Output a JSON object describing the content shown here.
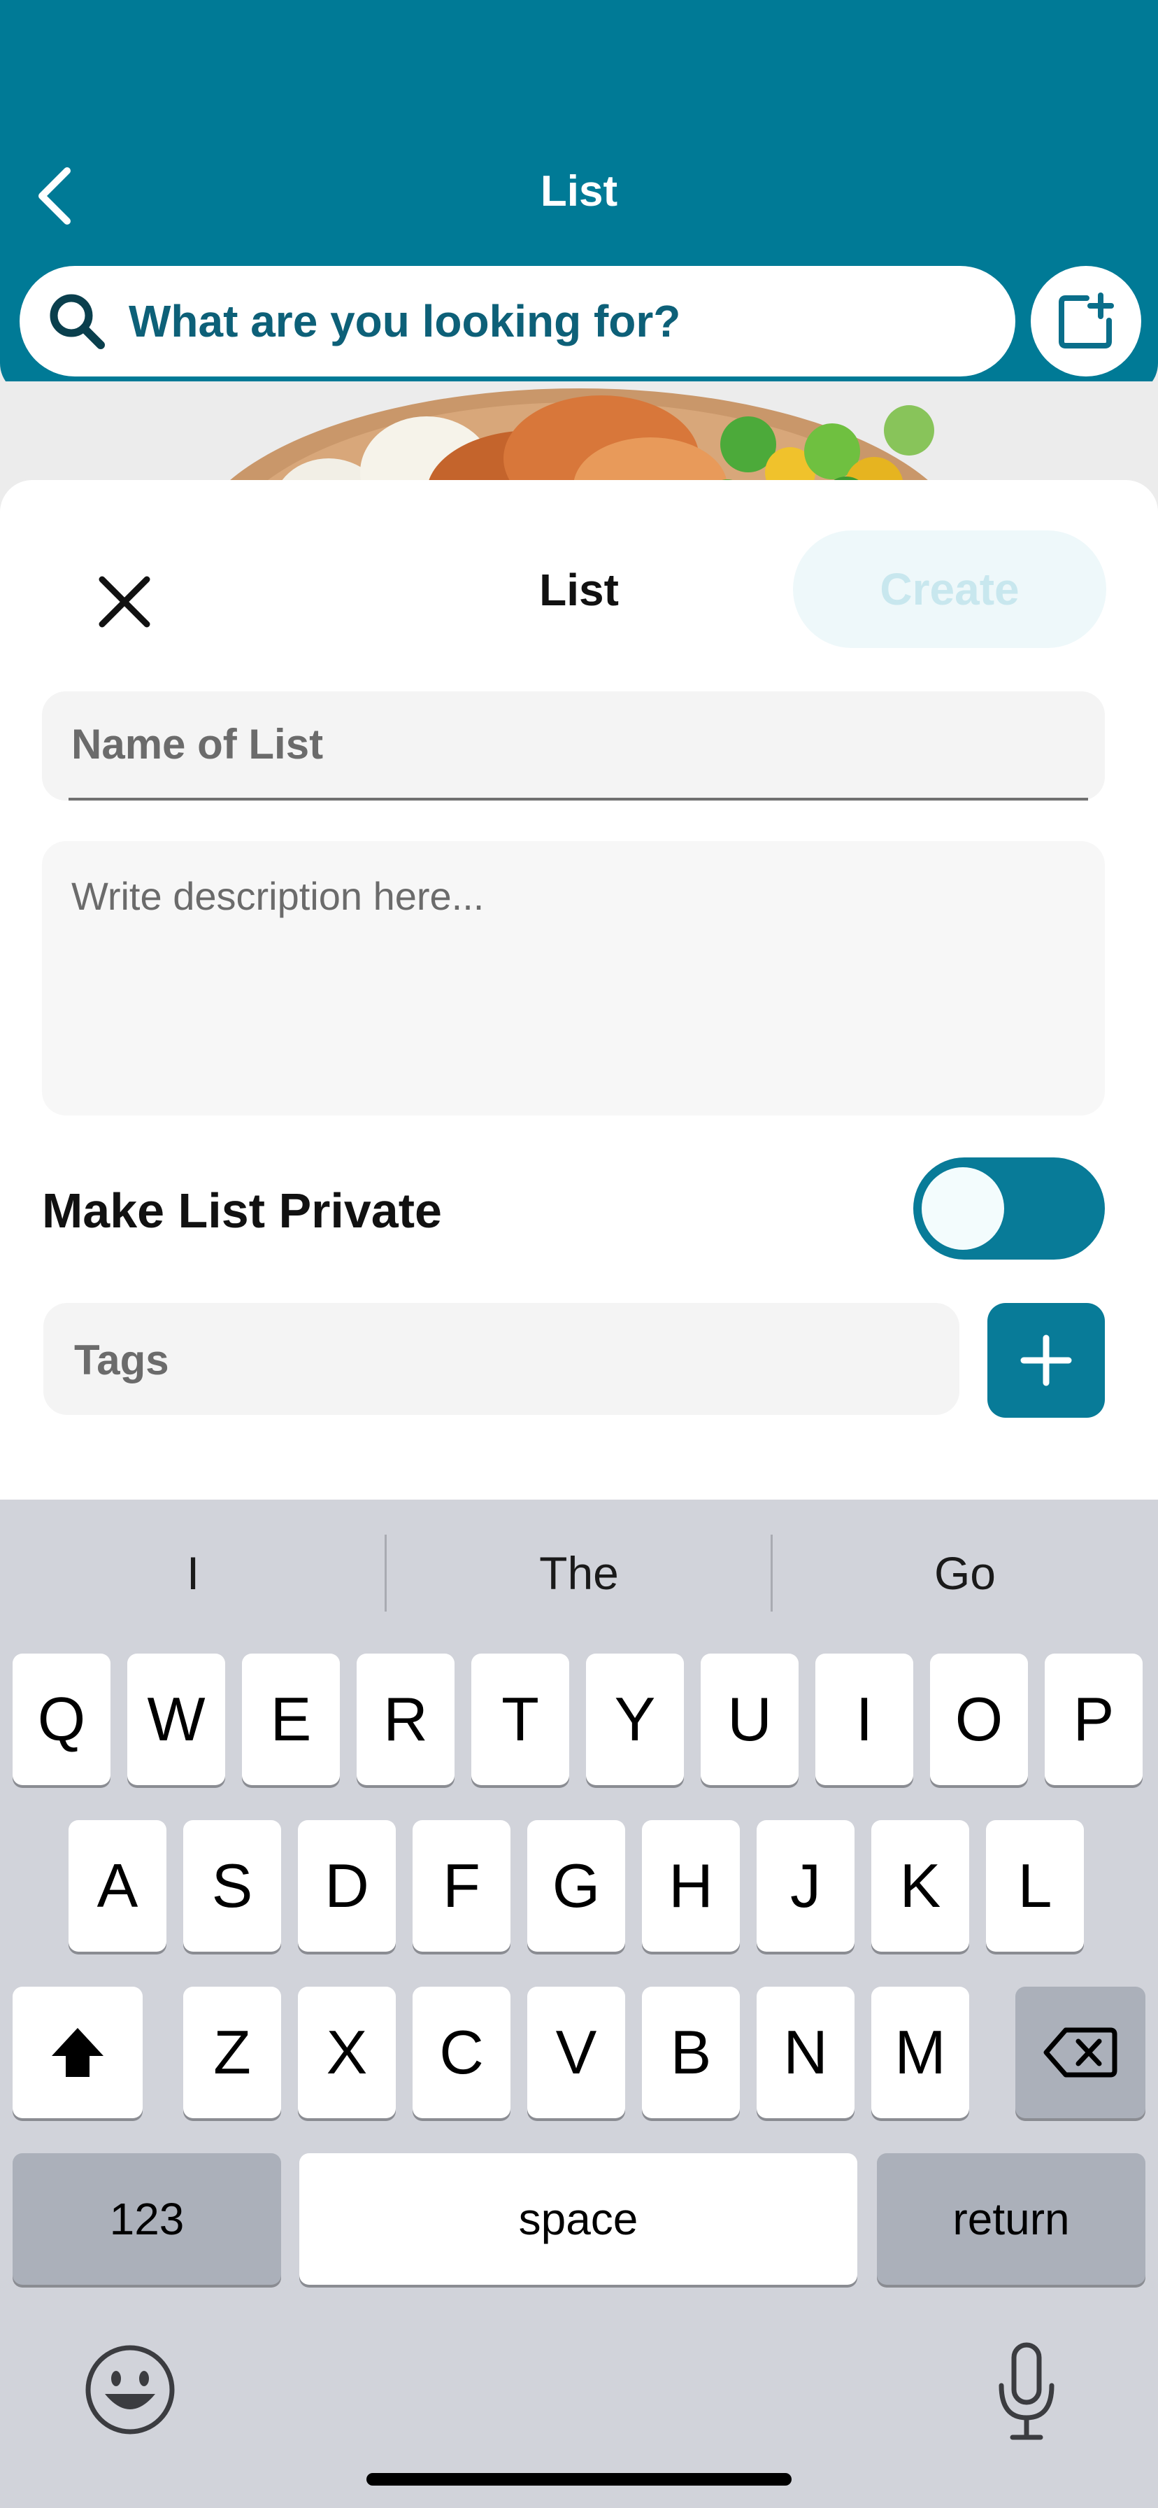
{
  "header": {
    "title": "List",
    "search_placeholder": "What are you looking for?"
  },
  "sheet": {
    "title": "List",
    "create_label": "Create",
    "name_placeholder": "Name of List",
    "description_placeholder": "Write description here...",
    "private_label": "Make List Private",
    "private_toggle_on": true,
    "tags_placeholder": "Tags"
  },
  "keyboard": {
    "suggestions": [
      "I",
      "The",
      "Go"
    ],
    "row1": [
      "Q",
      "W",
      "E",
      "R",
      "T",
      "Y",
      "U",
      "I",
      "O",
      "P"
    ],
    "row2": [
      "A",
      "S",
      "D",
      "F",
      "G",
      "H",
      "J",
      "K",
      "L"
    ],
    "row3": [
      "Z",
      "X",
      "C",
      "V",
      "B",
      "N",
      "M"
    ],
    "numbers_label": "123",
    "space_label": "space",
    "return_label": "return"
  },
  "colors": {
    "brand": "#007a96",
    "toggle": "#087b98",
    "create_disabled_bg": "#eef8fa",
    "create_disabled_text": "#c8e7ee"
  }
}
